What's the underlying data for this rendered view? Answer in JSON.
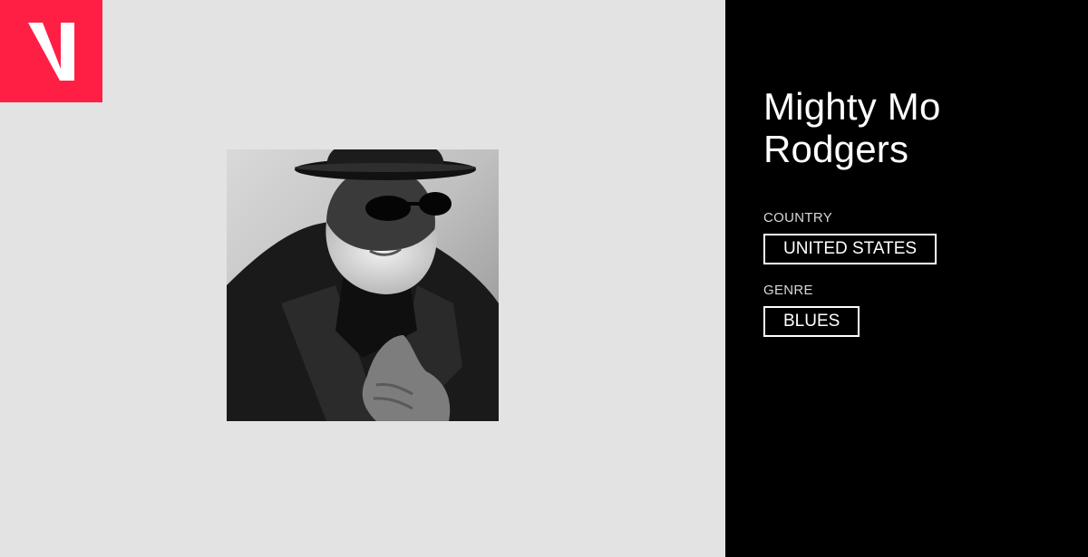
{
  "brand": {
    "logo_icon": "v-logo-icon",
    "color": "#ff1f45"
  },
  "artist": {
    "name": "Mighty Mo Rodgers",
    "photo_icon": "artist-portrait"
  },
  "details": {
    "country_label": "COUNTRY",
    "country_value": "UNITED STATES",
    "genre_label": "GENRE",
    "genre_value": "BLUES"
  },
  "colors": {
    "left_background": "#e3e3e3",
    "right_background": "#000000",
    "text": "#ffffff"
  }
}
